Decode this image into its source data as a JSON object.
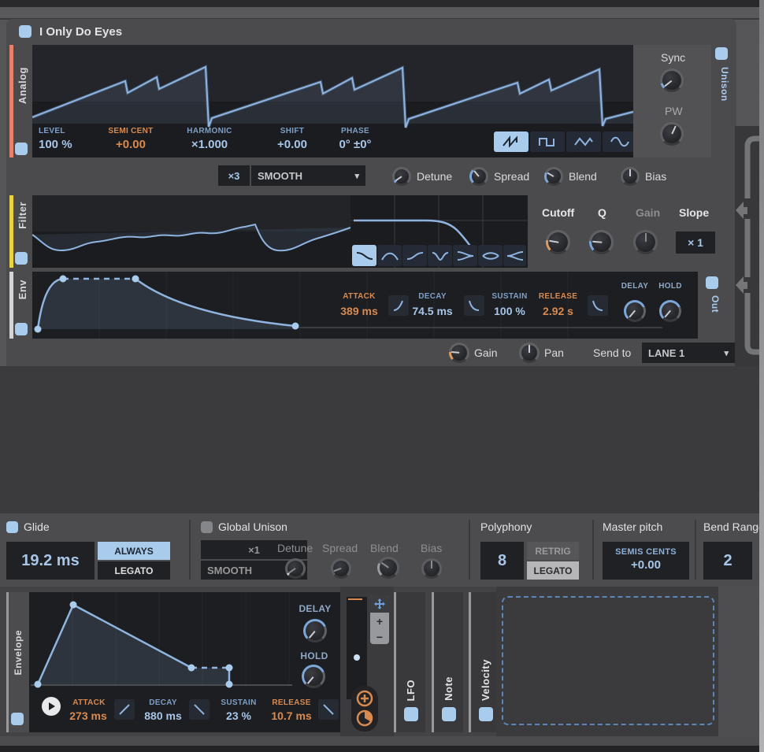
{
  "icons": {
    "dropdown_arrow": "▾"
  },
  "header": {
    "preset_name": "I Only Do Eyes"
  },
  "generator": {
    "analog": {
      "label": "Analog",
      "params": [
        {
          "label": "LEVEL",
          "value": "100 %"
        },
        {
          "label": "SEMI CENT",
          "value": "+0.00"
        },
        {
          "label": "HARMONIC",
          "value": "×1.000"
        },
        {
          "label": "SHIFT",
          "value": "+0.00"
        },
        {
          "label": "PHASE",
          "value": "0° ±0°"
        }
      ],
      "sync_label": "Sync",
      "pw_label": "PW",
      "unison_label": "Unison"
    },
    "unison_row": {
      "voices": "×3",
      "mode": "SMOOTH",
      "knob_labels": [
        "Detune",
        "Spread",
        "Blend",
        "Bias"
      ]
    },
    "filter": {
      "label": "Filter",
      "cutoff_label": "Cutoff",
      "q_label": "Q",
      "gain_label": "Gain",
      "slope_label": "Slope",
      "slope_value": "× 1"
    },
    "env": {
      "label": "Env",
      "params": [
        {
          "label": "ATTACK",
          "value": "389 ms"
        },
        {
          "label": "DECAY",
          "value": "74.5 ms"
        },
        {
          "label": "SUSTAIN",
          "value": "100 %"
        },
        {
          "label": "RELEASE",
          "value": "2.92 s"
        }
      ],
      "delay_label": "DELAY",
      "hold_label": "HOLD",
      "out_label": "Out"
    },
    "output_row": {
      "gain_label": "Gain",
      "pan_label": "Pan",
      "send_to_label": "Send to",
      "send_to_value": "LANE 1"
    }
  },
  "settings": {
    "glide": {
      "label": "Glide",
      "value": "19.2 ms",
      "mode_always": "ALWAYS",
      "mode_legato": "LEGATO"
    },
    "global_unison": {
      "label": "Global Unison",
      "voices": "×1",
      "mode": "SMOOTH",
      "knob_labels": [
        "Detune",
        "Spread",
        "Blend",
        "Bias"
      ]
    },
    "polyphony": {
      "label": "Polyphony",
      "value": "8",
      "mode_retrig": "RETRIG",
      "mode_legato": "LEGATO"
    },
    "master_pitch": {
      "label": "Master pitch",
      "units": "SEMIS CENTS",
      "value": "+0.00"
    },
    "bend_range": {
      "label": "Bend Range",
      "value": "2"
    }
  },
  "modulators": {
    "envelope": {
      "label": "Envelope",
      "params": [
        {
          "label": "ATTACK",
          "value": "273 ms"
        },
        {
          "label": "DECAY",
          "value": "880 ms"
        },
        {
          "label": "SUSTAIN",
          "value": "23 %"
        },
        {
          "label": "RELEASE",
          "value": "10.7 ms"
        }
      ],
      "delay_label": "DELAY",
      "hold_label": "HOLD"
    },
    "tabs": [
      {
        "label": "LFO"
      },
      {
        "label": "Note"
      },
      {
        "label": "Velocity"
      }
    ]
  }
}
